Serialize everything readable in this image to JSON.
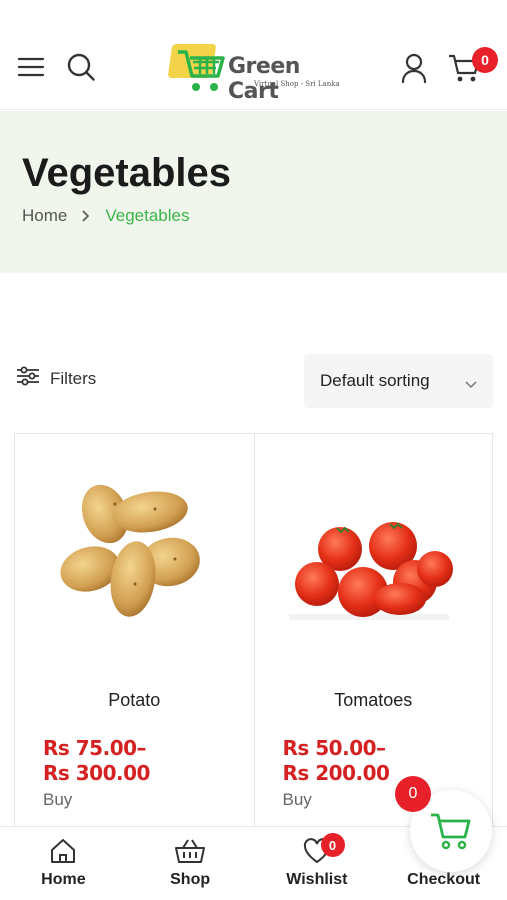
{
  "header": {
    "logo": {
      "title": "Green Cart",
      "subtitle": "Virtual Shop - Sri Lanka"
    },
    "cart_count": "0"
  },
  "banner": {
    "title": "Vegetables",
    "breadcrumb": {
      "home": "Home",
      "current": "Vegetables"
    }
  },
  "toolbar": {
    "filters_label": "Filters",
    "sort_value": "Default sorting"
  },
  "products": [
    {
      "name": "Potato",
      "price_line1": "Rs 75.00–",
      "price_line2": "Rs 300.00",
      "action": "Buy"
    },
    {
      "name": "Tomatoes",
      "price_line1": "Rs 50.00–",
      "price_line2": "Rs 200.00",
      "action": "Buy"
    }
  ],
  "floating_cart": {
    "count": "0"
  },
  "bottom_nav": {
    "items": [
      {
        "label": "Home",
        "icon": "home-icon"
      },
      {
        "label": "Shop",
        "icon": "basket-icon"
      },
      {
        "label": "Wishlist",
        "icon": "heart-icon",
        "badge": "0"
      },
      {
        "label": "Checkout",
        "icon": "checkout-icon"
      }
    ]
  },
  "colors": {
    "accent_green": "#3bb54a",
    "price_red": "#d42121",
    "badge_red": "#e8202a",
    "banner_bg": "#f1f6ec"
  }
}
